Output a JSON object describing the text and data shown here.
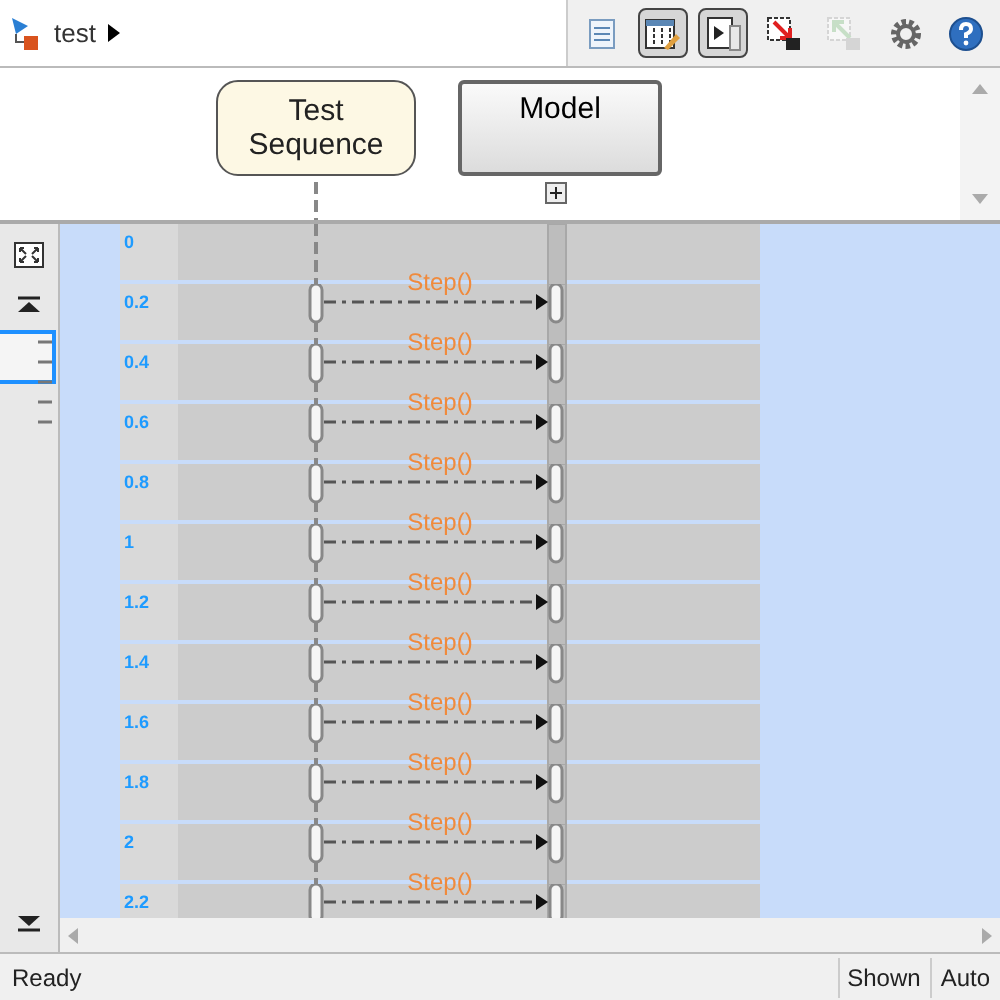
{
  "breadcrumb": {
    "label": "test"
  },
  "tools": [
    {
      "kind": "properties",
      "selected": false,
      "disabled": false
    },
    {
      "kind": "edit",
      "selected": true,
      "disabled": false
    },
    {
      "kind": "run",
      "selected": true,
      "disabled": false
    },
    {
      "kind": "export",
      "selected": false,
      "disabled": false
    },
    {
      "kind": "import",
      "selected": false,
      "disabled": true
    },
    {
      "kind": "settings",
      "selected": false,
      "disabled": false
    },
    {
      "kind": "help",
      "selected": false,
      "disabled": false
    }
  ],
  "lifelines": [
    {
      "label": "Test Sequence",
      "kind": "test"
    },
    {
      "label": "Model",
      "kind": "model"
    }
  ],
  "rows": [
    {
      "time": "0"
    },
    {
      "time": "0.2",
      "message": "Step()"
    },
    {
      "time": "0.4",
      "message": "Step()"
    },
    {
      "time": "0.6",
      "message": "Step()"
    },
    {
      "time": "0.8",
      "message": "Step()"
    },
    {
      "time": "1",
      "message": "Step()"
    },
    {
      "time": "1.2",
      "message": "Step()"
    },
    {
      "time": "1.4",
      "message": "Step()"
    },
    {
      "time": "1.6",
      "message": "Step()"
    },
    {
      "time": "1.8",
      "message": "Step()"
    },
    {
      "time": "2",
      "message": "Step()"
    },
    {
      "time": "2.2",
      "message": "Step()"
    }
  ],
  "status": {
    "text": "Ready",
    "fields": [
      "Shown",
      "Auto"
    ]
  }
}
